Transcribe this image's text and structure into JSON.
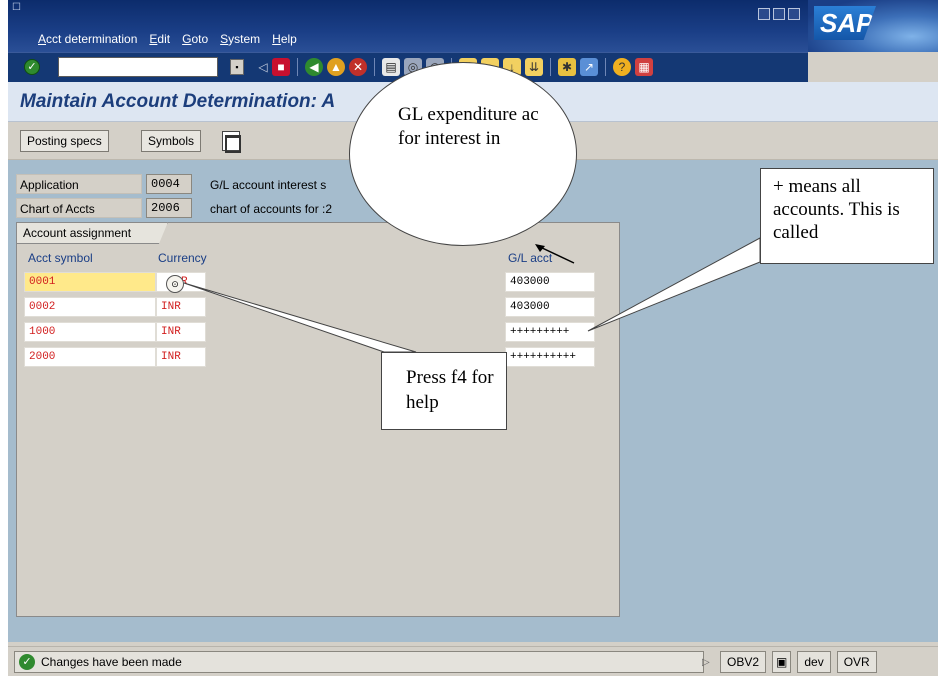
{
  "menu": {
    "items": [
      "Acct determination",
      "Edit",
      "Goto",
      "System",
      "Help"
    ]
  },
  "brand": {
    "logo_text": "SAP"
  },
  "screen": {
    "title": "Maintain Account Determination: A"
  },
  "app_toolbar": {
    "posting_specs": "Posting specs",
    "symbols": "Symbols"
  },
  "header_fields": [
    {
      "label": "Application",
      "value": "0004",
      "desc": "G/L account interest s"
    },
    {
      "label": "Chart of Accts",
      "value": "2006",
      "desc": "chart of accounts for :2"
    }
  ],
  "group": {
    "tab_label": "Account assignment",
    "columns": {
      "acct_symbol": "Acct symbol",
      "currency": "Currency",
      "gl_acct": "G/L acct"
    },
    "rows": [
      {
        "symbol": "0001",
        "currency": "R",
        "gl": "403000"
      },
      {
        "symbol": "0002",
        "currency": "INR",
        "gl": "403000"
      },
      {
        "symbol": "1000",
        "currency": "INR",
        "gl": "+++++++++"
      },
      {
        "symbol": "2000",
        "currency": "INR",
        "gl": "++++++++++"
      }
    ]
  },
  "callouts": {
    "bubble_text": "GL expenditure ac for interest in",
    "right_note": "+ means all accounts. This is called",
    "press_note": "Press f4 for help"
  },
  "status": {
    "message": "Changes have been made",
    "tcode": "OBV2",
    "system": "dev",
    "mode": "OVR"
  },
  "colors": {
    "title_blue": "#1c3e7c",
    "key_red": "#d21e1e",
    "field_yellow": "#ffe98a",
    "work_area": "#a5bccd"
  }
}
